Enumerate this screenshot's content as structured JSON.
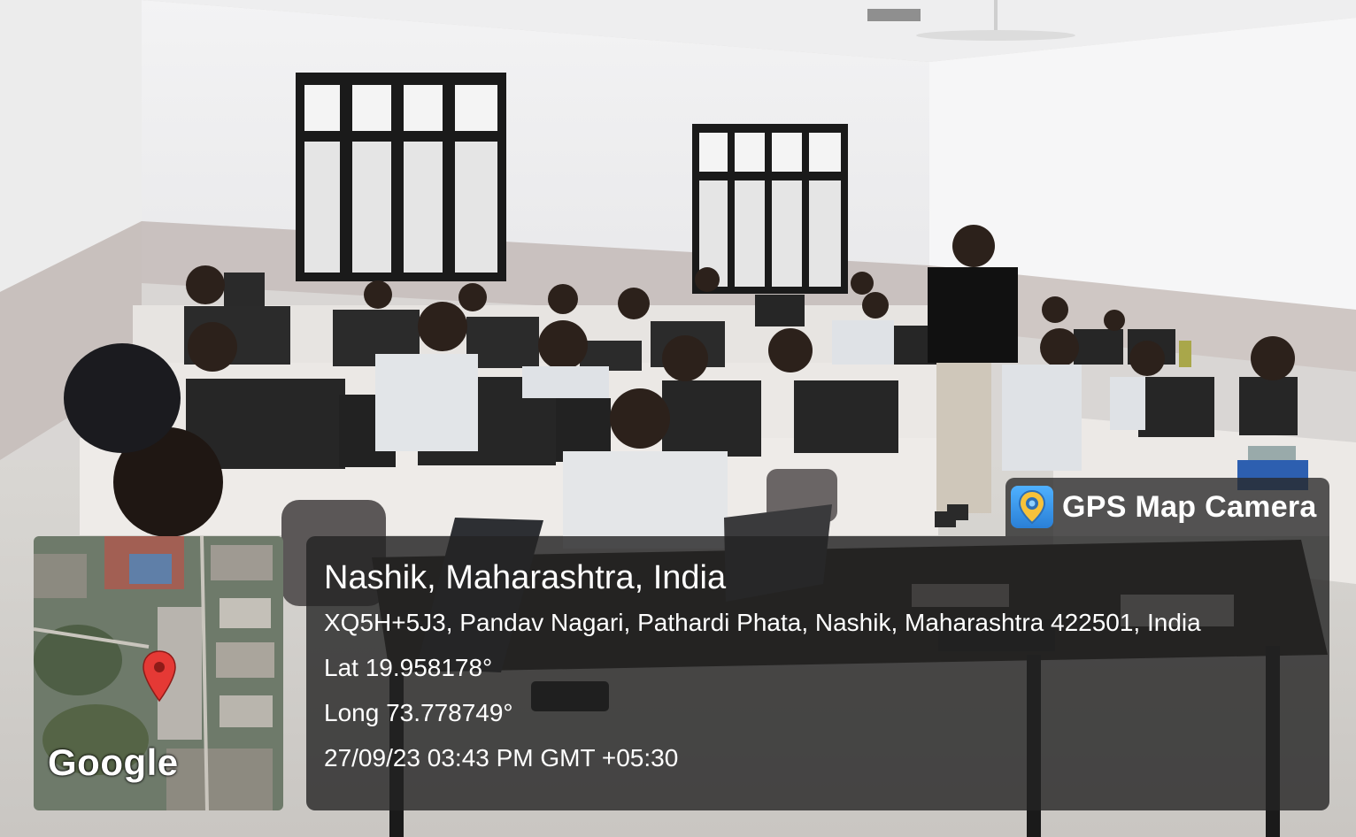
{
  "badge": {
    "app_name": "GPS Map Camera",
    "icon": "map-pin-camera-icon"
  },
  "location": {
    "city": "Nashik, Maharashtra, India",
    "address": "XQ5H+5J3, Pandav Nagari, Pathardi Phata, Nashik, Maharashtra 422501, India",
    "lat": "Lat 19.958178°",
    "long": "Long 73.778749°",
    "datetime": "27/09/23 03:43 PM GMT +05:30"
  },
  "map_thumbnail": {
    "provider_logo": "Google",
    "marker_icon": "map-marker-icon",
    "marker_color": "#e53935"
  }
}
